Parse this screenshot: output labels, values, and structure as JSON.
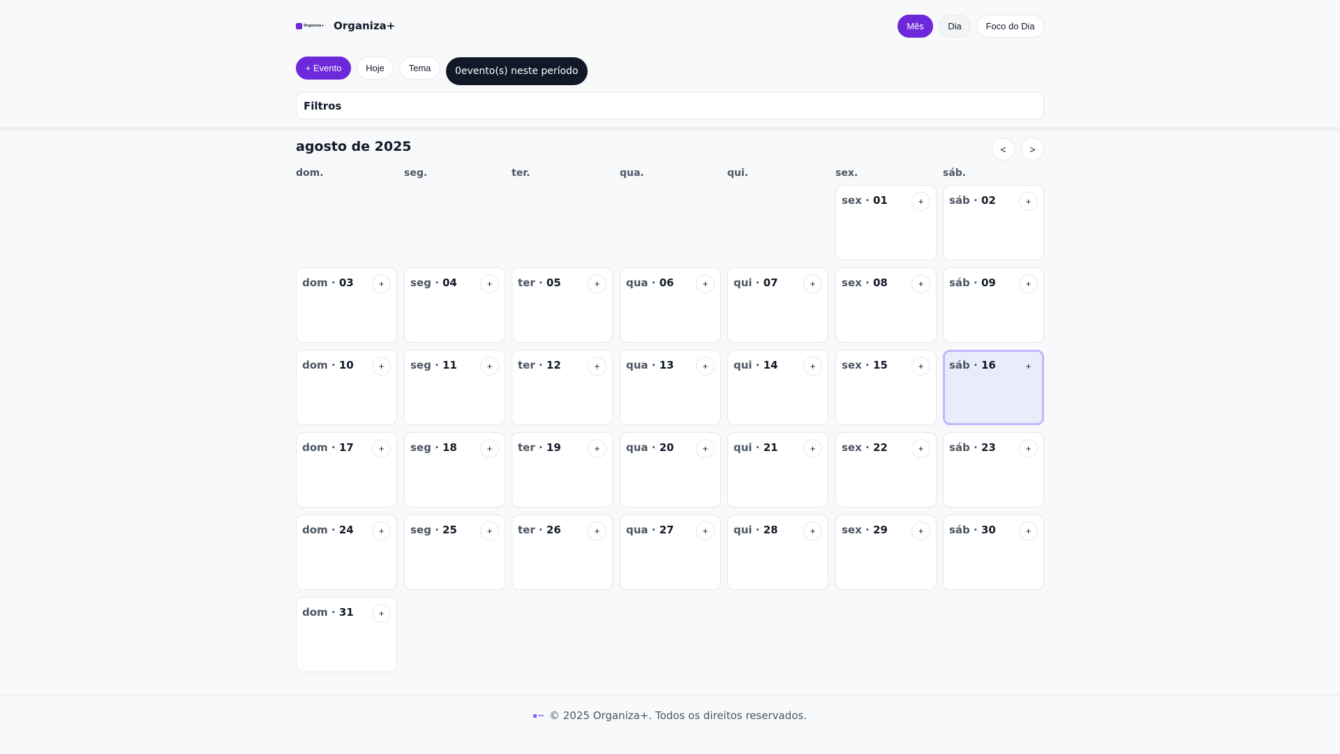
{
  "app": {
    "name": "Organiza+",
    "logo_text": "Organiza+"
  },
  "view_switch": {
    "month": "Mês",
    "day": "Dia",
    "focus": "Foco do Dia"
  },
  "actions": {
    "add_event": "+ Evento",
    "today": "Hoje",
    "theme": "Tema",
    "event_count": "0evento(s) neste período"
  },
  "filters": {
    "label": "Filtros"
  },
  "calendar": {
    "month_title": "agosto de 2025",
    "prev": "<",
    "next": ">",
    "weekdays": [
      "dom.",
      "seg.",
      "ter.",
      "qua.",
      "qui.",
      "sex.",
      "sáb."
    ],
    "add_label": "+",
    "today_day": "16",
    "days": [
      {
        "wd": "sex",
        "d": "01"
      },
      {
        "wd": "sáb",
        "d": "02"
      },
      {
        "wd": "dom",
        "d": "03"
      },
      {
        "wd": "seg",
        "d": "04"
      },
      {
        "wd": "ter",
        "d": "05"
      },
      {
        "wd": "qua",
        "d": "06"
      },
      {
        "wd": "qui",
        "d": "07"
      },
      {
        "wd": "sex",
        "d": "08"
      },
      {
        "wd": "sáb",
        "d": "09"
      },
      {
        "wd": "dom",
        "d": "10"
      },
      {
        "wd": "seg",
        "d": "11"
      },
      {
        "wd": "ter",
        "d": "12"
      },
      {
        "wd": "qua",
        "d": "13"
      },
      {
        "wd": "qui",
        "d": "14"
      },
      {
        "wd": "sex",
        "d": "15"
      },
      {
        "wd": "sáb",
        "d": "16"
      },
      {
        "wd": "dom",
        "d": "17"
      },
      {
        "wd": "seg",
        "d": "18"
      },
      {
        "wd": "ter",
        "d": "19"
      },
      {
        "wd": "qua",
        "d": "20"
      },
      {
        "wd": "qui",
        "d": "21"
      },
      {
        "wd": "sex",
        "d": "22"
      },
      {
        "wd": "sáb",
        "d": "23"
      },
      {
        "wd": "dom",
        "d": "24"
      },
      {
        "wd": "seg",
        "d": "25"
      },
      {
        "wd": "ter",
        "d": "26"
      },
      {
        "wd": "qua",
        "d": "27"
      },
      {
        "wd": "qui",
        "d": "28"
      },
      {
        "wd": "sex",
        "d": "29"
      },
      {
        "wd": "sáb",
        "d": "30"
      },
      {
        "wd": "dom",
        "d": "31"
      }
    ],
    "first_weekday_index": 5
  },
  "footer": {
    "text": "© 2025 Organiza+. Todos os direitos reservados."
  },
  "colors": {
    "accent": "#6d28d9",
    "dark_badge": "#111827",
    "today_bg": "#e8ecfb",
    "today_border": "#c4b5fd"
  }
}
